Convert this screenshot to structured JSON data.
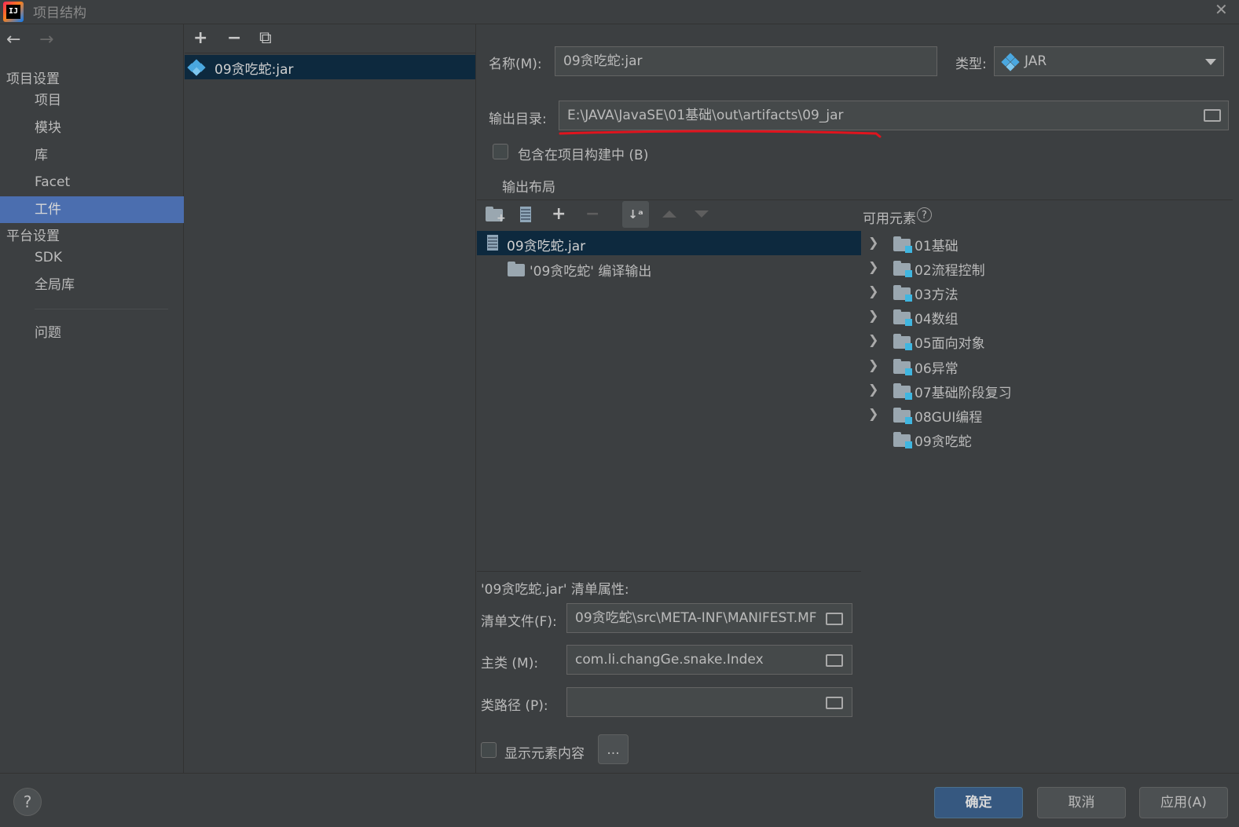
{
  "window": {
    "title": "项目结构",
    "close_glyph": "✕"
  },
  "nav": {
    "back_glyph": "←",
    "forward_glyph": "→",
    "project_settings_header": "项目设置",
    "project_items": [
      "项目",
      "模块",
      "库",
      "Facet",
      "工件"
    ],
    "selected_item": "工件",
    "platform_settings_header": "平台设置",
    "platform_items": [
      "SDK",
      "全局库"
    ],
    "problems": "问题"
  },
  "artifacts": {
    "add_glyph": "+",
    "remove_glyph": "−",
    "copy_glyph": "⧉",
    "items": [
      "09贪吃蛇:jar"
    ]
  },
  "form": {
    "name_label": "名称(M):",
    "name_value": "09贪吃蛇:jar",
    "type_label": "类型:",
    "type_value": "JAR",
    "output_dir_label": "输出目录:",
    "output_dir_value": "E:\\JAVA\\JavaSE\\01基础\\out\\artifacts\\09_jar",
    "include_in_build_label": "包含在项目构建中 (B)",
    "include_in_build_checked": false,
    "output_layout_label": "输出布局",
    "available_elements_label": "可用元素",
    "help_glyph": "?"
  },
  "layout_tree": {
    "root": "09贪吃蛇.jar",
    "children": [
      "'09贪吃蛇' 编译输出"
    ]
  },
  "available_tree": [
    {
      "label": "01基础",
      "expandable": true
    },
    {
      "label": "02流程控制",
      "expandable": true
    },
    {
      "label": "03方法",
      "expandable": true
    },
    {
      "label": "04数组",
      "expandable": true
    },
    {
      "label": "05面向对象",
      "expandable": true
    },
    {
      "label": "06异常",
      "expandable": true
    },
    {
      "label": "07基础阶段复习",
      "expandable": true
    },
    {
      "label": "08GUI编程",
      "expandable": true
    },
    {
      "label": "09贪吃蛇",
      "expandable": false
    }
  ],
  "manifest": {
    "header": "'09贪吃蛇.jar' 清单属性:",
    "file_label": "清单文件(F):",
    "file_value": "09贪吃蛇\\src\\META-INF\\MANIFEST.MF",
    "main_class_label": "主类 (M):",
    "main_class_value": "com.li.changGe.snake.Index",
    "classpath_label": "类路径 (P):",
    "classpath_value": "",
    "show_content_label": "显示元素内容",
    "show_content_checked": false,
    "more_button": "..."
  },
  "buttons": {
    "ok": "确定",
    "cancel": "取消",
    "apply": "应用(A)",
    "help": "?"
  },
  "colors": {
    "accent_selection": "#4b6eaf",
    "tree_selection": "#0d293e",
    "annotation_underline": "#e0141e",
    "primary_button": "#365880"
  }
}
